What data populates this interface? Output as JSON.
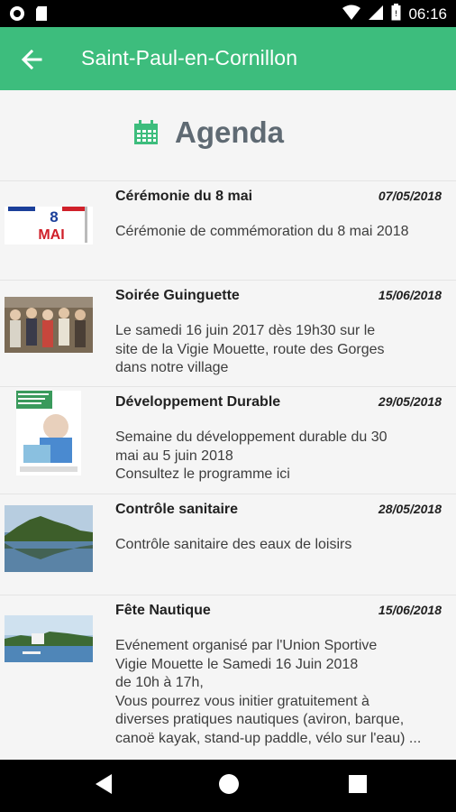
{
  "status_bar": {
    "time": "06:16"
  },
  "app_bar": {
    "title": "Saint-Paul-en-Cornillon"
  },
  "header": {
    "title": "Agenda"
  },
  "events": [
    {
      "title": "Cérémonie du 8 mai",
      "date": "07/05/2018",
      "description": "Cérémonie de commémoration du 8 mai 2018",
      "thumb_text": "8",
      "thumb_text2": "MAI"
    },
    {
      "title": "Soirée Guinguette",
      "date": "15/06/2018",
      "description": " Le samedi 16 juin 2017 dès 19h30 sur le\nsite de la Vigie Mouette, route des Gorges\ndans notre village"
    },
    {
      "title": "Développement Durable",
      "date": "29/05/2018",
      "description": "Semaine du développement durable du 30\nmai au 5 juin 2018\nConsultez le programme ici"
    },
    {
      "title": "Contrôle sanitaire",
      "date": "28/05/2018",
      "description": "Contrôle sanitaire des eaux de loisirs"
    },
    {
      "title": "Fête Nautique",
      "date": "15/06/2018",
      "description": "Evénement organisé par l'Union Sportive\nVigie Mouette le Samedi 16 Juin 2018\nde 10h à 17h,\nVous pourrez vous initier gratuitement à\ndiverses pratiques nautiques (aviron, barque,\ncanoë kayak, stand-up paddle, vélo sur l'eau) ..."
    }
  ]
}
